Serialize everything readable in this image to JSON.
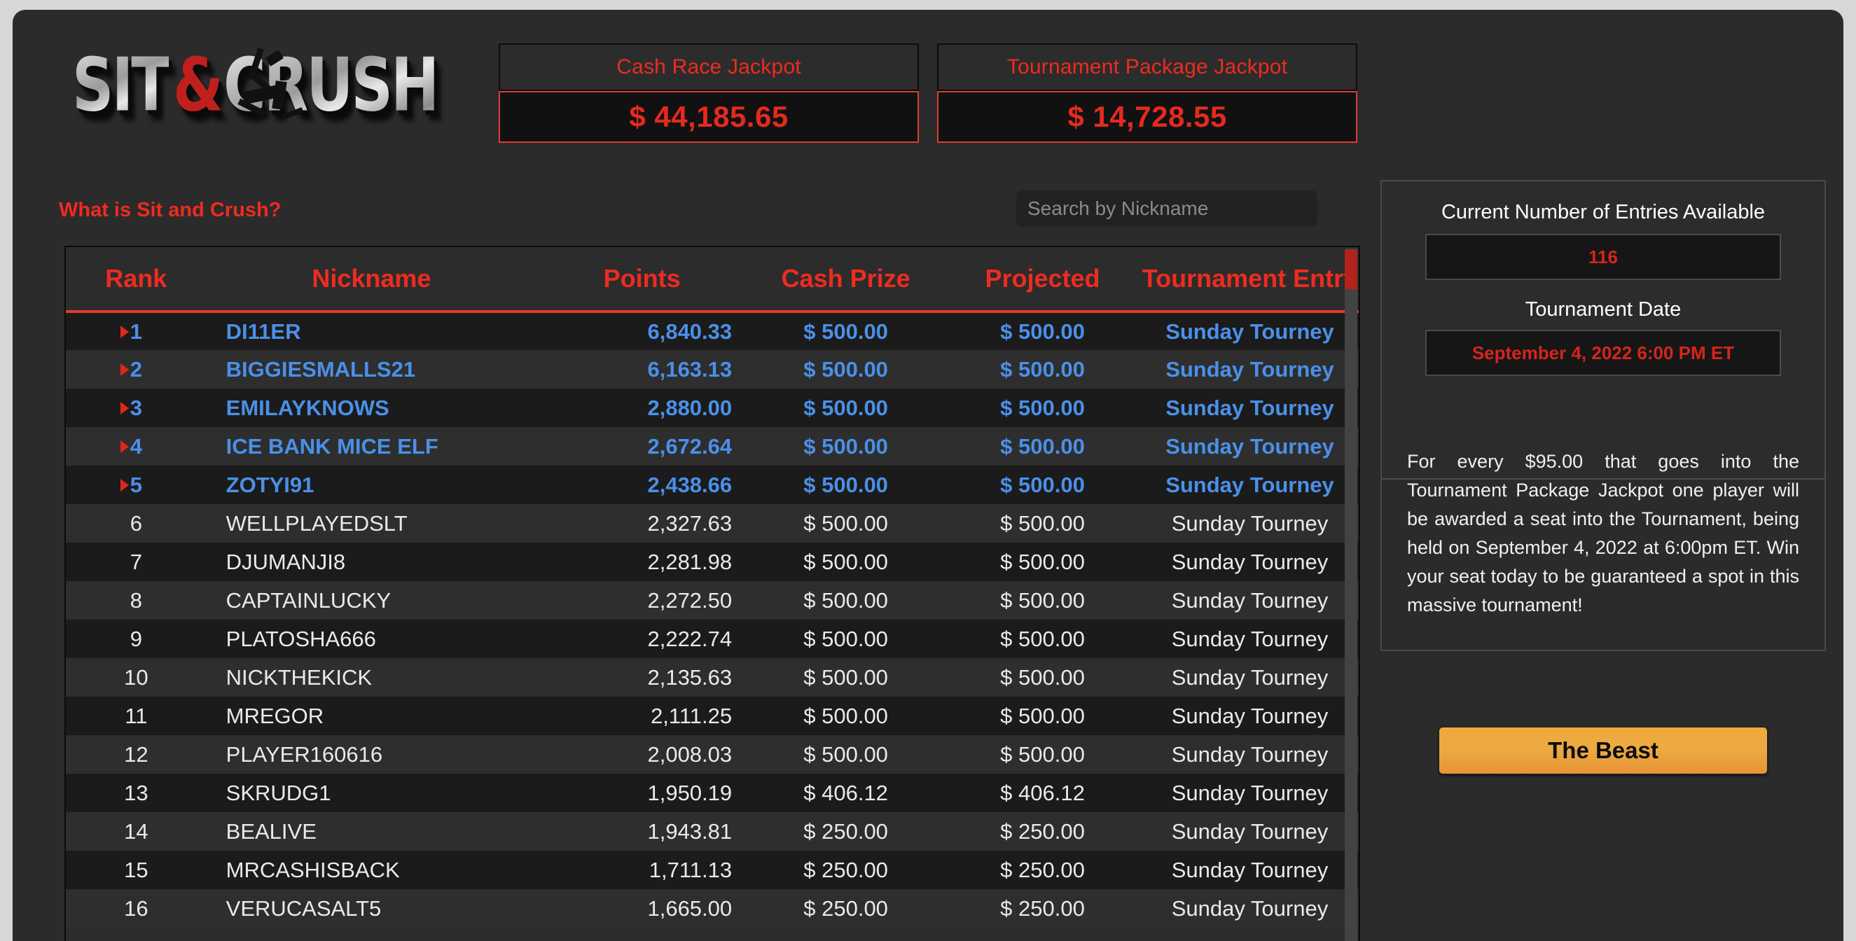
{
  "brand": {
    "logo_part1": "SIT",
    "logo_amp": "&",
    "logo_part2": "CRUSH"
  },
  "jackpots": [
    {
      "label": "Cash Race Jackpot",
      "value": "$ 44,185.65"
    },
    {
      "label": "Tournament Package Jackpot",
      "value": "$ 14,728.55"
    }
  ],
  "subbar": {
    "what_is_link": "What is Sit and Crush?",
    "search_placeholder": "Search by Nickname",
    "search_value": ""
  },
  "table": {
    "headers": [
      "Rank",
      "Nickname",
      "Points",
      "Cash Prize",
      "Projected",
      "Tournament Entry"
    ],
    "rows": [
      {
        "rank": "1",
        "nickname": "DI11ER",
        "points": "6,840.33",
        "cash": "$ 500.00",
        "projected": "$ 500.00",
        "entry": "Sunday Tourney",
        "highlight": true
      },
      {
        "rank": "2",
        "nickname": "BIGGIESMALLS21",
        "points": "6,163.13",
        "cash": "$ 500.00",
        "projected": "$ 500.00",
        "entry": "Sunday Tourney",
        "highlight": true
      },
      {
        "rank": "3",
        "nickname": "EMILAYKNOWS",
        "points": "2,880.00",
        "cash": "$ 500.00",
        "projected": "$ 500.00",
        "entry": "Sunday Tourney",
        "highlight": true
      },
      {
        "rank": "4",
        "nickname": "ICE BANK MICE ELF",
        "points": "2,672.64",
        "cash": "$ 500.00",
        "projected": "$ 500.00",
        "entry": "Sunday Tourney",
        "highlight": true
      },
      {
        "rank": "5",
        "nickname": "ZOTYI91",
        "points": "2,438.66",
        "cash": "$ 500.00",
        "projected": "$ 500.00",
        "entry": "Sunday Tourney",
        "highlight": true
      },
      {
        "rank": "6",
        "nickname": "WELLPLAYEDSLT",
        "points": "2,327.63",
        "cash": "$ 500.00",
        "projected": "$ 500.00",
        "entry": "Sunday Tourney",
        "highlight": false
      },
      {
        "rank": "7",
        "nickname": "DJUMANJI8",
        "points": "2,281.98",
        "cash": "$ 500.00",
        "projected": "$ 500.00",
        "entry": "Sunday Tourney",
        "highlight": false
      },
      {
        "rank": "8",
        "nickname": "CAPTAINLUCKY",
        "points": "2,272.50",
        "cash": "$ 500.00",
        "projected": "$ 500.00",
        "entry": "Sunday Tourney",
        "highlight": false
      },
      {
        "rank": "9",
        "nickname": "PLATOSHA666",
        "points": "2,222.74",
        "cash": "$ 500.00",
        "projected": "$ 500.00",
        "entry": "Sunday Tourney",
        "highlight": false
      },
      {
        "rank": "10",
        "nickname": "NICKTHEKICK",
        "points": "2,135.63",
        "cash": "$ 500.00",
        "projected": "$ 500.00",
        "entry": "Sunday Tourney",
        "highlight": false
      },
      {
        "rank": "11",
        "nickname": "MREGOR",
        "points": "2,111.25",
        "cash": "$ 500.00",
        "projected": "$ 500.00",
        "entry": "Sunday Tourney",
        "highlight": false
      },
      {
        "rank": "12",
        "nickname": "PLAYER160616",
        "points": "2,008.03",
        "cash": "$ 500.00",
        "projected": "$ 500.00",
        "entry": "Sunday Tourney",
        "highlight": false
      },
      {
        "rank": "13",
        "nickname": "SKRUDG1",
        "points": "1,950.19",
        "cash": "$ 406.12",
        "projected": "$ 406.12",
        "entry": "Sunday Tourney",
        "highlight": false
      },
      {
        "rank": "14",
        "nickname": "BEALIVE",
        "points": "1,943.81",
        "cash": "$ 250.00",
        "projected": "$ 250.00",
        "entry": "Sunday Tourney",
        "highlight": false
      },
      {
        "rank": "15",
        "nickname": "MRCASHISBACK",
        "points": "1,711.13",
        "cash": "$ 250.00",
        "projected": "$ 250.00",
        "entry": "Sunday Tourney",
        "highlight": false
      },
      {
        "rank": "16",
        "nickname": "VERUCASALT5",
        "points": "1,665.00",
        "cash": "$ 250.00",
        "projected": "$ 250.00",
        "entry": "Sunday Tourney",
        "highlight": false
      }
    ]
  },
  "sidebar": {
    "entries_label": "Current Number of Entries Available",
    "entries_value": "116",
    "date_label": "Tournament Date",
    "date_value": "September 4, 2022 6:00 PM ET",
    "note": "For every $95.00 that goes into the Tournament Package Jackpot one player will be awarded a seat into the Tournament, being held on September 4, 2022 at 6:00pm ET. Win your seat today to be guaranteed a spot in this massive tournament!",
    "beast_button": "The Beast"
  },
  "colors": {
    "accent_red": "#ee2b20",
    "highlight_blue": "#4a90e8",
    "button_orange": "#ecab42",
    "page_bg": "#2b2b2b"
  }
}
